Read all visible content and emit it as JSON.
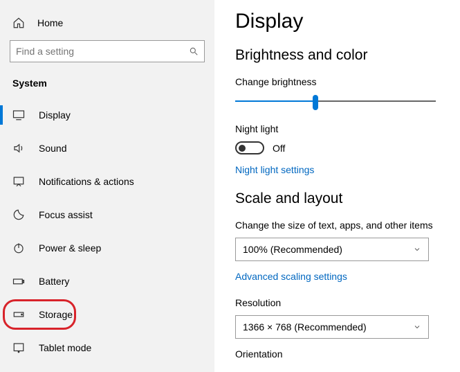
{
  "sidebar": {
    "home": "Home",
    "search_placeholder": "Find a setting",
    "section": "System",
    "items": [
      {
        "label": "Display"
      },
      {
        "label": "Sound"
      },
      {
        "label": "Notifications & actions"
      },
      {
        "label": "Focus assist"
      },
      {
        "label": "Power & sleep"
      },
      {
        "label": "Battery"
      },
      {
        "label": "Storage"
      },
      {
        "label": "Tablet mode"
      }
    ]
  },
  "main": {
    "title": "Display",
    "brightness": {
      "heading": "Brightness and color",
      "label": "Change brightness",
      "value_pct": 40
    },
    "nightlight": {
      "label": "Night light",
      "state": "Off",
      "link": "Night light settings"
    },
    "scale": {
      "heading": "Scale and layout",
      "label": "Change the size of text, apps, and other items",
      "value": "100% (Recommended)",
      "link": "Advanced scaling settings"
    },
    "resolution": {
      "label": "Resolution",
      "value": "1366 × 768 (Recommended)"
    },
    "orientation": {
      "label": "Orientation"
    }
  }
}
